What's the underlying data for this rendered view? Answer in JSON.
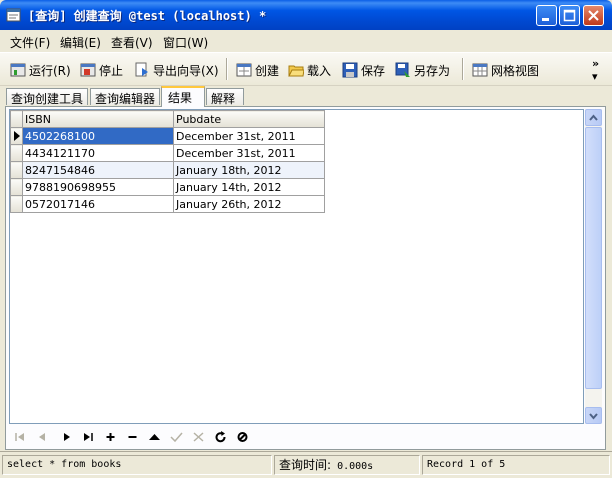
{
  "window": {
    "title": "[查询] 创建查询 @test (localhost) *"
  },
  "menu": [
    {
      "label": "文件(F)"
    },
    {
      "label": "编辑(E)"
    },
    {
      "label": "查看(V)"
    },
    {
      "label": "窗口(W)"
    }
  ],
  "toolbar": {
    "run": "运行(R)",
    "stop": "停止",
    "export": "导出向导(X)",
    "create": "创建",
    "load": "载入",
    "save": "保存",
    "save_as": "另存为",
    "grid_view": "网格视图"
  },
  "tabs": [
    {
      "label": "查询创建工具"
    },
    {
      "label": "查询编辑器"
    },
    {
      "label": "结果",
      "active": true
    },
    {
      "label": "解释"
    }
  ],
  "grid": {
    "columns": [
      "ISBN",
      "Pubdate"
    ],
    "rows": [
      {
        "isbn": "4502268100",
        "pubdate": "December 31st, 2011"
      },
      {
        "isbn": "4434121170",
        "pubdate": "December 31st, 2011"
      },
      {
        "isbn": "8247154846",
        "pubdate": "January 18th, 2012"
      },
      {
        "isbn": "9788190698955",
        "pubdate": "January 14th, 2012"
      },
      {
        "isbn": "0572017146",
        "pubdate": "January 26th, 2012"
      }
    ],
    "selected_row": 0
  },
  "navigator": {
    "icons": [
      "first-icon",
      "prev-icon",
      "next-icon",
      "last-icon",
      "add-icon",
      "delete-icon",
      "up-icon",
      "apply-icon",
      "cancel-icon",
      "refresh-icon",
      "stop-icon"
    ]
  },
  "status": {
    "sql": "select * from books",
    "time_label": "查询时间:",
    "time_value": " 0.000s",
    "record": "Record 1 of 5"
  },
  "colors": {
    "title_blue": "#0054E3",
    "selection": "#316AC5",
    "tab_highlight": "#FFC83C"
  }
}
